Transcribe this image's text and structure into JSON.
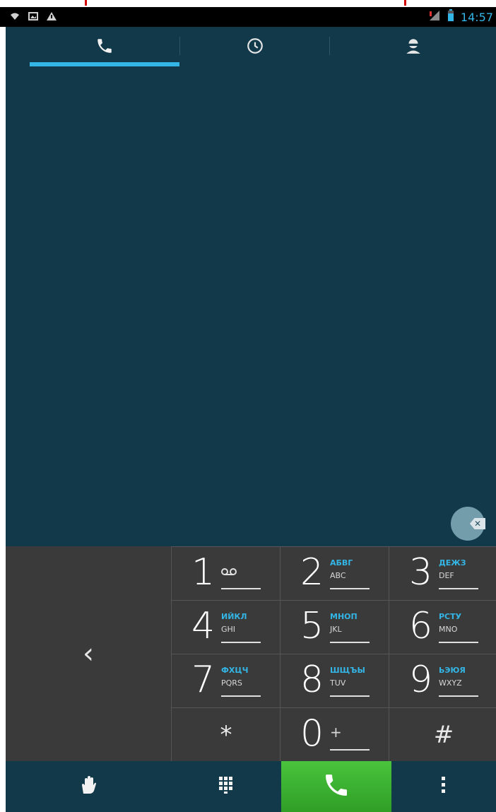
{
  "statusbar": {
    "left_icons": [
      "wifi-icon",
      "image-icon",
      "warning-icon"
    ],
    "right_icons": [
      "signal-icon",
      "battery-icon"
    ],
    "time": "14:57"
  },
  "tabs": [
    {
      "icon": "phone-icon",
      "selected": true
    },
    {
      "icon": "clock-icon",
      "selected": false
    },
    {
      "icon": "contact-icon",
      "selected": false
    }
  ],
  "dial_input": {
    "value": ""
  },
  "keypad": {
    "back_label": "‹",
    "keys": [
      {
        "digit": "1",
        "cyr": "",
        "lat": "ω"
      },
      {
        "digit": "2",
        "cyr": "АБВГ",
        "lat": "ABC"
      },
      {
        "digit": "3",
        "cyr": "ДЕЖЗ",
        "lat": "DEF"
      },
      {
        "digit": "4",
        "cyr": "ИЙКЛ",
        "lat": "GHI"
      },
      {
        "digit": "5",
        "cyr": "МНОП",
        "lat": "JKL"
      },
      {
        "digit": "6",
        "cyr": "РСТУ",
        "lat": "MNO"
      },
      {
        "digit": "7",
        "cyr": "ФХЦЧ",
        "lat": "PQRS"
      },
      {
        "digit": "8",
        "cyr": "ШЩЪЫ",
        "lat": "TUV"
      },
      {
        "digit": "9",
        "cyr": "ЬЭЮЯ",
        "lat": "WXYZ"
      },
      {
        "digit": "*",
        "cyr": "",
        "lat": ""
      },
      {
        "digit": "0",
        "cyr": "",
        "lat": "+"
      },
      {
        "digit": "#",
        "cyr": "",
        "lat": ""
      }
    ]
  },
  "bottombar": {
    "items": [
      "hand-icon",
      "dialpad-icon",
      "call-icon",
      "overflow-menu-icon"
    ]
  },
  "colors": {
    "accent": "#33b5e5",
    "call": "#3db335",
    "background": "#12394a"
  }
}
